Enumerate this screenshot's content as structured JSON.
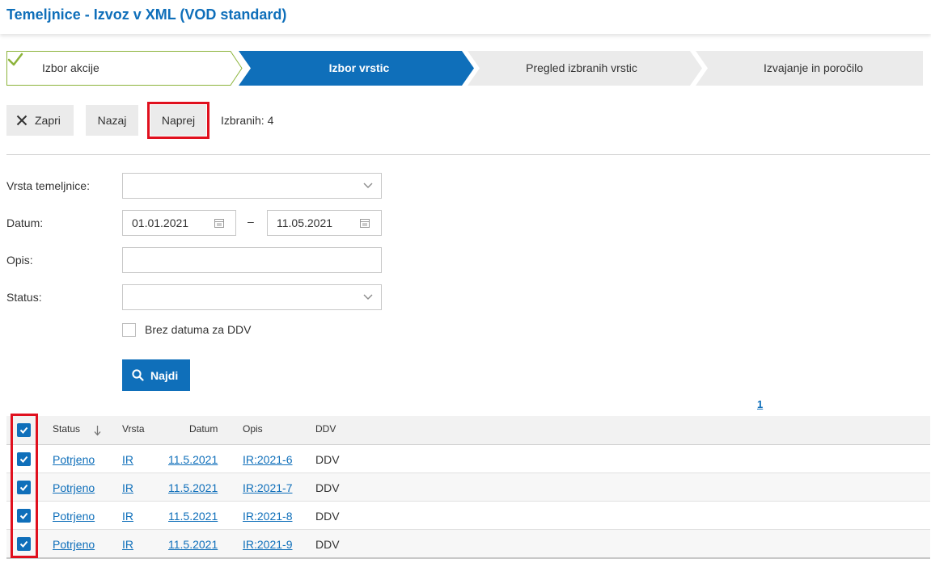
{
  "page": {
    "title": "Temeljnice - Izvoz v XML (VOD standard)"
  },
  "wizard": {
    "steps": [
      {
        "label": "Izbor akcije",
        "state": "done"
      },
      {
        "label": "Izbor vrstic",
        "state": "active"
      },
      {
        "label": "Pregled izbranih vrstic",
        "state": "pending"
      },
      {
        "label": "Izvajanje in poročilo",
        "state": "pending"
      }
    ]
  },
  "toolbar": {
    "close_label": "Zapri",
    "back_label": "Nazaj",
    "next_label": "Naprej",
    "selected_text": "Izbranih: 4"
  },
  "filters": {
    "type_label": "Vrsta temeljnice:",
    "type_value": "",
    "date_label": "Datum:",
    "date_from": "01.01.2021",
    "date_separator": "–",
    "date_to": "11.05.2021",
    "description_label": "Opis:",
    "description_value": "",
    "status_label": "Status:",
    "status_value": "",
    "no_vat_date_label": "Brez datuma za DDV",
    "no_vat_date_checked": false,
    "find_label": "Najdi"
  },
  "pager": {
    "current": "1"
  },
  "table": {
    "columns": [
      "Status",
      "Vrsta",
      "Datum",
      "Opis",
      "DDV"
    ],
    "all_selected": true,
    "rows": [
      {
        "selected": true,
        "status": "Potrjeno",
        "type": "IR",
        "date": "11.5.2021",
        "description": "IR:2021-6",
        "vat": "DDV"
      },
      {
        "selected": true,
        "status": "Potrjeno",
        "type": "IR",
        "date": "11.5.2021",
        "description": "IR:2021-7",
        "vat": "DDV"
      },
      {
        "selected": true,
        "status": "Potrjeno",
        "type": "IR",
        "date": "11.5.2021",
        "description": "IR:2021-8",
        "vat": "DDV"
      },
      {
        "selected": true,
        "status": "Potrjeno",
        "type": "IR",
        "date": "11.5.2021",
        "description": "IR:2021-9",
        "vat": "DDV"
      }
    ]
  },
  "colors": {
    "brand_blue": "#0f6fba",
    "done_step_green": "#8cb33a",
    "highlight_red": "#e0101e"
  }
}
